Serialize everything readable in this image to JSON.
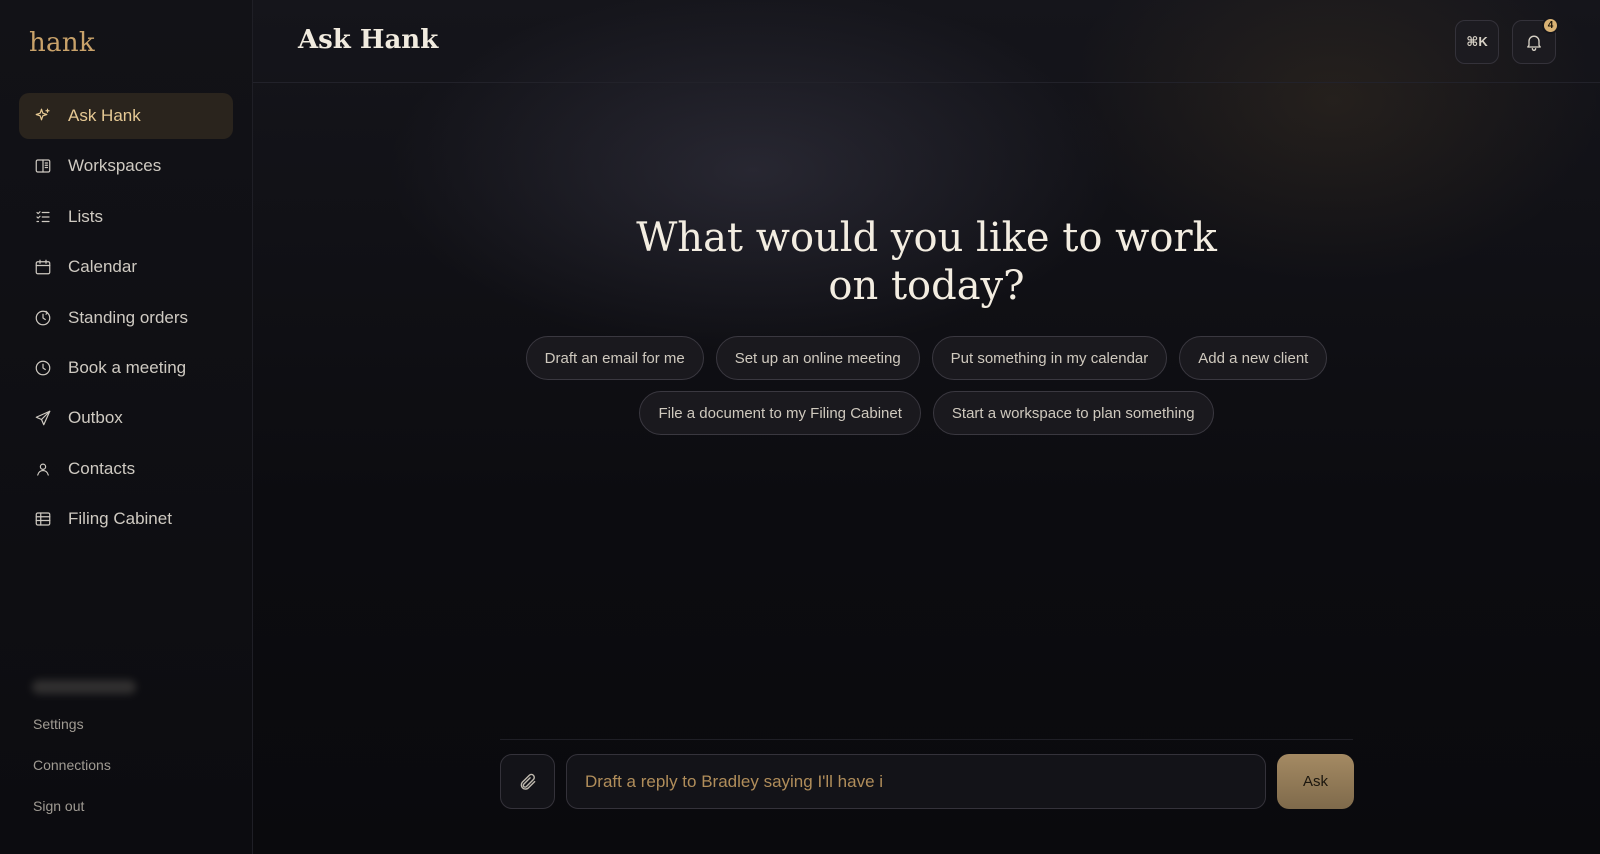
{
  "app": {
    "logo": "hank"
  },
  "sidebar": {
    "items": [
      {
        "label": "Ask Hank",
        "icon": "sparkle-icon",
        "active": true
      },
      {
        "label": "Workspaces",
        "icon": "book-icon"
      },
      {
        "label": "Lists",
        "icon": "checklist-icon"
      },
      {
        "label": "Calendar",
        "icon": "calendar-icon"
      },
      {
        "label": "Standing orders",
        "icon": "recurring-icon"
      },
      {
        "label": "Book a meeting",
        "icon": "clock-icon"
      },
      {
        "label": "Outbox",
        "icon": "send-icon"
      },
      {
        "label": "Contacts",
        "icon": "user-icon"
      },
      {
        "label": "Filing Cabinet",
        "icon": "cabinet-icon"
      }
    ],
    "footer": {
      "settings": "Settings",
      "connections": "Connections",
      "sign_out": "Sign out"
    }
  },
  "header": {
    "title": "Ask Hank",
    "shortcut_label": "⌘K",
    "notification_count": "4"
  },
  "hero": {
    "line1": "What would you like to work",
    "line2": "on today?"
  },
  "suggestions": {
    "row1": [
      "Draft an email for me",
      "Set up an online meeting",
      "Put something in my calendar",
      "Add a new client"
    ],
    "row2": [
      "File a document to my Filing Cabinet",
      "Start a workspace to plan something"
    ]
  },
  "composer": {
    "input_value": "Draft a reply to Bradley saying I'll have i",
    "submit_label": "Ask"
  },
  "colors": {
    "accent": "#c9a26a",
    "active_bg": "#2a241d",
    "background": "#0b0b0e"
  }
}
